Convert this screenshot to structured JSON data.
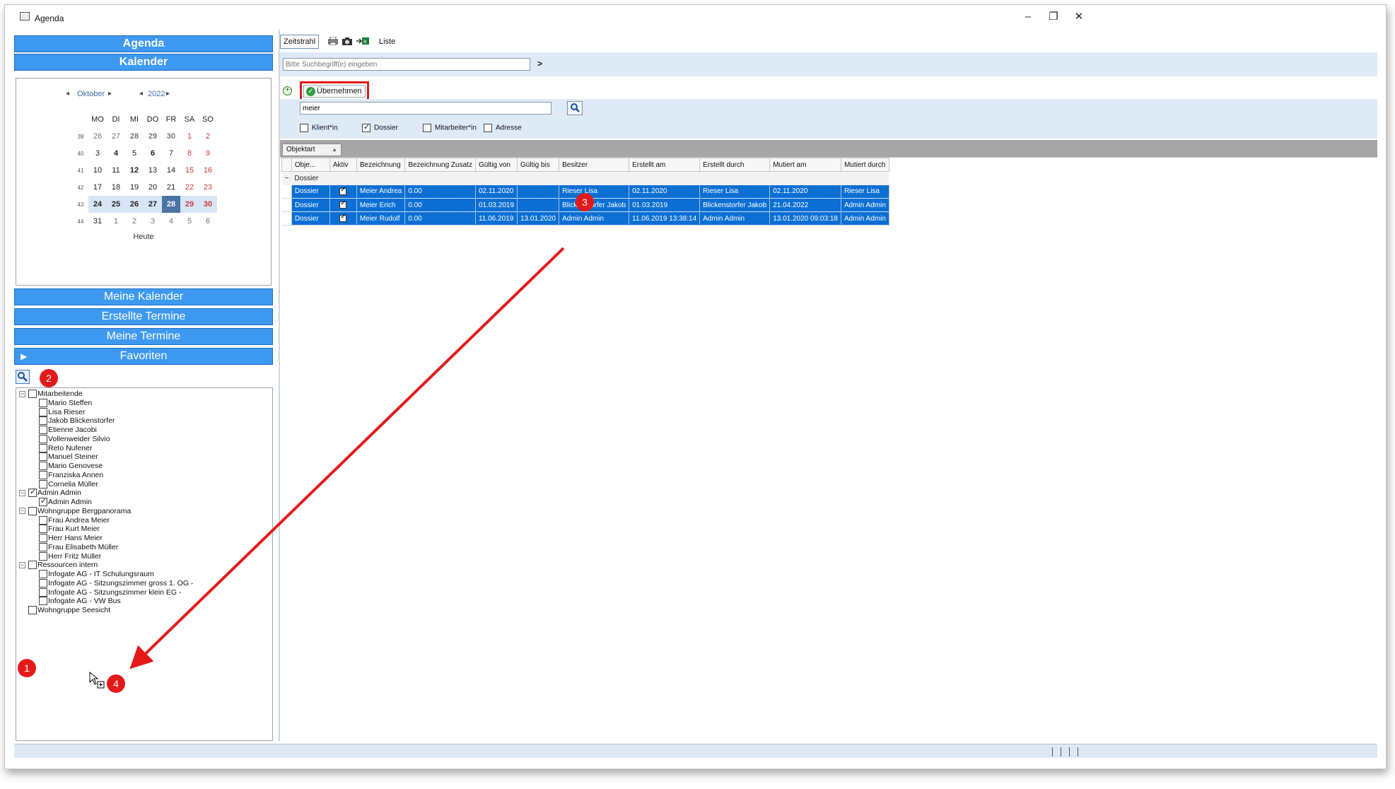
{
  "window": {
    "title": "Agenda",
    "minimize": "–",
    "restore": "❐",
    "close": "✕"
  },
  "left": {
    "nav_agenda": "Agenda",
    "nav_kalender": "Kalender",
    "calendar": {
      "month": "Oktober",
      "year": "2022",
      "weekdays": [
        "MO",
        "DI",
        "MI",
        "DO",
        "FR",
        "SA",
        "SO"
      ],
      "weeks": [
        {
          "wk": "39",
          "days": [
            "26",
            "27",
            "28",
            "29",
            "30",
            "1",
            "2"
          ]
        },
        {
          "wk": "40",
          "days": [
            "3",
            "4",
            "5",
            "6",
            "7",
            "8",
            "9"
          ]
        },
        {
          "wk": "41",
          "days": [
            "10",
            "11",
            "12",
            "13",
            "14",
            "15",
            "16"
          ]
        },
        {
          "wk": "42",
          "days": [
            "17",
            "18",
            "19",
            "20",
            "21",
            "22",
            "23"
          ]
        },
        {
          "wk": "43",
          "days": [
            "24",
            "25",
            "26",
            "27",
            "28",
            "29",
            "30"
          ]
        },
        {
          "wk": "44",
          "days": [
            "31",
            "1",
            "2",
            "3",
            "4",
            "5",
            "6"
          ]
        }
      ],
      "today_label": "Heute"
    },
    "nav_meine_kalender": "Meine Kalender",
    "nav_erstellte_termine": "Erstellte Termine",
    "nav_meine_termine": "Meine Termine",
    "nav_favoriten": "Favoriten",
    "tree": [
      {
        "label": "Mitarbeitende",
        "level": 0,
        "checked": false,
        "expander": "−"
      },
      {
        "label": "Mario Steffen",
        "level": 1,
        "checked": false
      },
      {
        "label": "Lisa Rieser",
        "level": 1,
        "checked": false
      },
      {
        "label": "Jakob Blickenstorfer",
        "level": 1,
        "checked": false
      },
      {
        "label": "Etienne Jacobi",
        "level": 1,
        "checked": false
      },
      {
        "label": "Vollenweider Silvio",
        "level": 1,
        "checked": false
      },
      {
        "label": "Reto Nufener",
        "level": 1,
        "checked": false
      },
      {
        "label": "Manuel Steiner",
        "level": 1,
        "checked": false
      },
      {
        "label": "Mario Genovese",
        "level": 1,
        "checked": false
      },
      {
        "label": "Franziska Annen",
        "level": 1,
        "checked": false
      },
      {
        "label": "Cornelia Müller",
        "level": 1,
        "checked": false
      },
      {
        "label": "Admin Admin",
        "level": 0,
        "checked": true,
        "expander": "−"
      },
      {
        "label": "Admin Admin",
        "level": 1,
        "checked": true
      },
      {
        "label": "Wohngruppe Bergpanorama",
        "level": 0,
        "checked": false,
        "expander": "−"
      },
      {
        "label": "Frau Andrea Meier",
        "level": 1,
        "checked": false
      },
      {
        "label": "Frau Kurt Meier",
        "level": 1,
        "checked": false
      },
      {
        "label": "Herr Hans Meier",
        "level": 1,
        "checked": false
      },
      {
        "label": "Frau Elisabeth Müller",
        "level": 1,
        "checked": false
      },
      {
        "label": "Herr Fritz Müller",
        "level": 1,
        "checked": false
      },
      {
        "label": "Ressourcen intern",
        "level": 0,
        "checked": false,
        "expander": "−"
      },
      {
        "label": "Infogate AG -  IT Schulungsraum",
        "level": 1,
        "checked": false
      },
      {
        "label": "Infogate AG -  Sitzungszimmer gross 1. OG -",
        "level": 1,
        "checked": false
      },
      {
        "label": "Infogate AG -  Sitzungszimmer klein EG -",
        "level": 1,
        "checked": false
      },
      {
        "label": "Infogate AG -  VW Bus",
        "level": 1,
        "checked": false
      },
      {
        "label": "Wohngruppe Seesicht",
        "level": 0,
        "checked": false,
        "expander": ""
      }
    ]
  },
  "right": {
    "toolbar": {
      "zeitstrahl": "Zeitstrahl",
      "liste": "Liste"
    },
    "search": {
      "placeholder": "Bitte Suchbegriff(e) eingeben",
      "go": ">"
    },
    "adopt_label": "Übernehmen",
    "filter": {
      "value": "meier",
      "options": [
        {
          "label": "Klient*in",
          "checked": false
        },
        {
          "label": "Dossier",
          "checked": true
        },
        {
          "label": "Mitarbeiter*in",
          "checked": false
        },
        {
          "label": "Adresse",
          "checked": false
        }
      ]
    },
    "group_chip": "Objektart",
    "grid": {
      "columns": [
        "Obje...",
        "Aktiv",
        "Bezeichnung",
        "Bezeichnung Zusatz",
        "Gültig von",
        "Gültig bis",
        "Besitzer",
        "Erstellt am",
        "Erstellt durch",
        "Mutiert am",
        "Mutiert durch"
      ],
      "group_label": "Dossier",
      "group_toggle": "−",
      "rows": [
        {
          "objekt": "Dossier",
          "aktiv": true,
          "bezeichnung": "Meier Andrea",
          "zusatz": "0.00",
          "von": "02.11.2020",
          "bis": "",
          "besitzer": "Rieser Lisa",
          "erstellt_am": "02.11.2020",
          "erstellt_durch": "Rieser Lisa",
          "mutiert_am": "02.11.2020",
          "mutiert_durch": "Rieser Lisa"
        },
        {
          "objekt": "Dossier",
          "aktiv": true,
          "bezeichnung": "Meier Erich",
          "zusatz": "0.00",
          "von": "01.03.2019",
          "bis": "",
          "besitzer": "Blickenstorfer Jakob",
          "erstellt_am": "01.03.2019",
          "erstellt_durch": "Blickenstorfer Jakob",
          "mutiert_am": "21.04.2022",
          "mutiert_durch": "Admin Admin"
        },
        {
          "objekt": "Dossier",
          "aktiv": true,
          "bezeichnung": "Meier Rudolf",
          "zusatz": "0.00",
          "von": "11.06.2019",
          "bis": "13.01.2020",
          "besitzer": "Admin Admin",
          "erstellt_am": "11.06.2019 13:38:14",
          "erstellt_durch": "Admin Admin",
          "mutiert_am": "13.01.2020 09:03:18",
          "mutiert_durch": "Admin Admin"
        }
      ]
    }
  },
  "annotations": [
    "1",
    "2",
    "3",
    "4"
  ],
  "colors": {
    "nav_blue": "#3d99f0",
    "selection_blue": "#0b6fd4",
    "annotation_red": "#e41a1a",
    "strip_blue": "#dfeaf7"
  }
}
